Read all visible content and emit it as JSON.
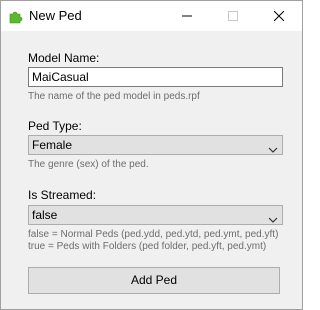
{
  "window": {
    "title": "New Ped"
  },
  "form": {
    "model_name": {
      "label": "Model Name:",
      "value": "MaiCasual",
      "hint": "The name of the ped model in peds.rpf"
    },
    "ped_type": {
      "label": "Ped Type:",
      "selected": "Female",
      "hint": "The genre (sex) of the ped."
    },
    "is_streamed": {
      "label": "Is Streamed:",
      "selected": "false",
      "hint_false": "false = Normal Peds (ped.ydd, ped.ytd, ped.ymt, ped.yft)",
      "hint_true": "true = Peds with Folders (ped folder, ped.yft, ped.ymt)"
    },
    "submit_label": "Add Ped"
  },
  "icons": {
    "app": "puzzle-piece-icon",
    "app_color": "#5cb82e"
  }
}
